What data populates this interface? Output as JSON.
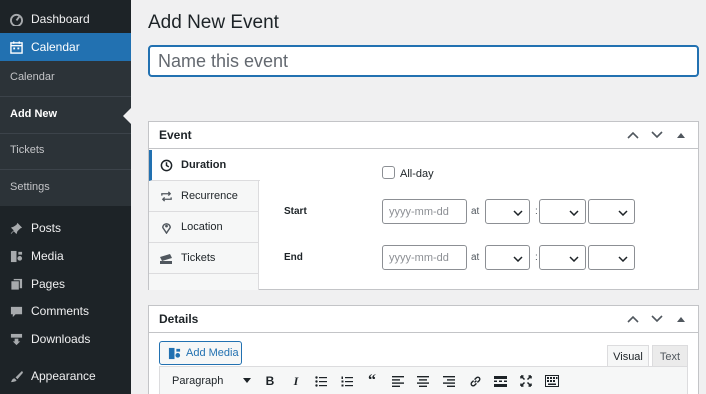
{
  "sidebar": {
    "items": [
      {
        "label": "Dashboard",
        "icon": "dashboard-icon"
      },
      {
        "label": "Calendar",
        "icon": "calendar-icon",
        "active": true
      },
      {
        "label": "Posts",
        "icon": "pushpin-icon"
      },
      {
        "label": "Media",
        "icon": "media-icon"
      },
      {
        "label": "Pages",
        "icon": "pages-icon"
      },
      {
        "label": "Comments",
        "icon": "comment-icon"
      },
      {
        "label": "Downloads",
        "icon": "download-icon"
      },
      {
        "label": "Appearance",
        "icon": "paintbrush-icon"
      }
    ],
    "submenu": [
      "Calendar",
      "Add New",
      "Tickets",
      "Settings"
    ],
    "submenu_current": "Add New"
  },
  "page": {
    "title": "Add New Event",
    "title_placeholder": "Name this event"
  },
  "event_box": {
    "title": "Event",
    "tabs": [
      {
        "label": "Duration",
        "icon": "clock-icon"
      },
      {
        "label": "Recurrence",
        "icon": "repeat-icon"
      },
      {
        "label": "Location",
        "icon": "location-pin-icon"
      },
      {
        "label": "Tickets",
        "icon": "tickets-icon"
      }
    ],
    "allday_label": "All-day",
    "start_label": "Start",
    "end_label": "End",
    "date_placeholder": "yyyy-mm-dd",
    "at_label": "at",
    "colon": ":"
  },
  "details_box": {
    "title": "Details",
    "add_media_label": "Add Media",
    "tab_visual": "Visual",
    "tab_text": "Text",
    "format_select": "Paragraph"
  },
  "colors": {
    "accent": "#2271b1",
    "sidebar_bg": "#1d2327",
    "submenu_bg": "#2c3338"
  }
}
